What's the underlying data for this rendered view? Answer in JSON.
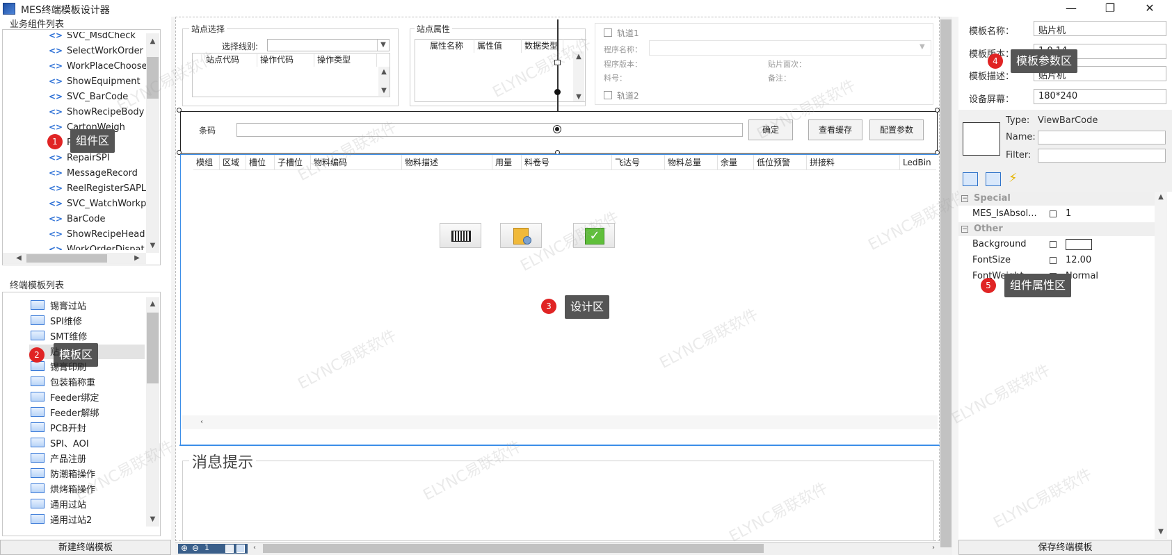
{
  "window": {
    "title": "MES终端模板设计器",
    "minimize": "—",
    "maximize": "❐",
    "close": "✕"
  },
  "left": {
    "components_label": "业务组件列表",
    "components": [
      "SVC_MsdCheck",
      "SelectWorkOrder",
      "WorkPlaceChoose",
      "ShowEquipment",
      "SVC_BarCode",
      "ShowRecipeBody",
      "CartonWeigh",
      "Re",
      "RepairSPI",
      "MessageRecord",
      "ReelRegisterSAPL",
      "SVC_WatchWorkp",
      "BarCode",
      "ShowRecipeHead",
      "WorkOrderDispat"
    ],
    "templates_label": "终端模板列表",
    "templates": [
      "锡膏过站",
      "SPI维修",
      "SMT维修",
      "贴",
      "锡膏印刷",
      "包装箱称重",
      "Feeder绑定",
      "Feeder解绑",
      "PCB开封",
      "SPI、AOI",
      "产品注册",
      "防潮箱操作",
      "烘烤箱操作",
      "通用过站",
      "通用过站2"
    ],
    "new_template_button": "新建终端模板"
  },
  "callouts": [
    {
      "num": "1",
      "text": "组件区"
    },
    {
      "num": "2",
      "text": "模板区"
    },
    {
      "num": "3",
      "text": "设计区"
    },
    {
      "num": "4",
      "text": "模板参数区"
    },
    {
      "num": "5",
      "text": "组件属性区"
    }
  ],
  "designer": {
    "station_select": {
      "title": "站点选择",
      "level_label": "选择线别:",
      "columns": [
        "站点代码",
        "操作代码",
        "操作类型"
      ]
    },
    "station_props": {
      "title": "站点属性",
      "columns": [
        "属性名称",
        "属性值",
        "数据类型"
      ]
    },
    "track1": {
      "label": "轨道1",
      "program_name": "程序名称：",
      "program_version": "程序版本：",
      "placement_side": "贴片面次：",
      "material_no": "料号：",
      "remark": "备注："
    },
    "track2": {
      "label": "轨道2"
    },
    "barcode_label": "条码",
    "confirm_button": "确定",
    "view_cache_button": "查看缓存",
    "config_button": "配置参数",
    "grid_columns": [
      "模组",
      "区域",
      "槽位",
      "子槽位",
      "物料编码",
      "物料描述",
      "用量",
      "料卷号",
      "飞达号",
      "物料总量",
      "余量",
      "低位预警",
      "拼接料",
      "LedBin"
    ],
    "message_title": "消息提示",
    "zoom_value": "1"
  },
  "watermark": "ELYNC易联软件",
  "template_params": {
    "name_label": "模板名称：",
    "name_value": "贴片机",
    "version_label": "模板版本：",
    "version_value": "1.0.14",
    "desc_label": "模板描述：",
    "desc_value": "贴片机",
    "screen_label": "设备屏幕：",
    "screen_value": "180*240"
  },
  "properties": {
    "type_label": "Type:",
    "type_value": "ViewBarCode",
    "name_label": "Name:",
    "filter_label": "Filter:",
    "categories": [
      {
        "name": "Special",
        "rows": [
          {
            "name": "MES_IsAbsol...",
            "value": "1"
          }
        ]
      },
      {
        "name": "Other",
        "rows": [
          {
            "name": "Background",
            "value": ""
          },
          {
            "name": "FontSize",
            "value": "12.00"
          },
          {
            "name": "FontWeight",
            "value": "Normal"
          }
        ]
      }
    ],
    "save_button": "保存终端模板"
  },
  "colors": {
    "accent": "#3b8ee8",
    "badge": "#e02424",
    "callout": "#555555"
  }
}
